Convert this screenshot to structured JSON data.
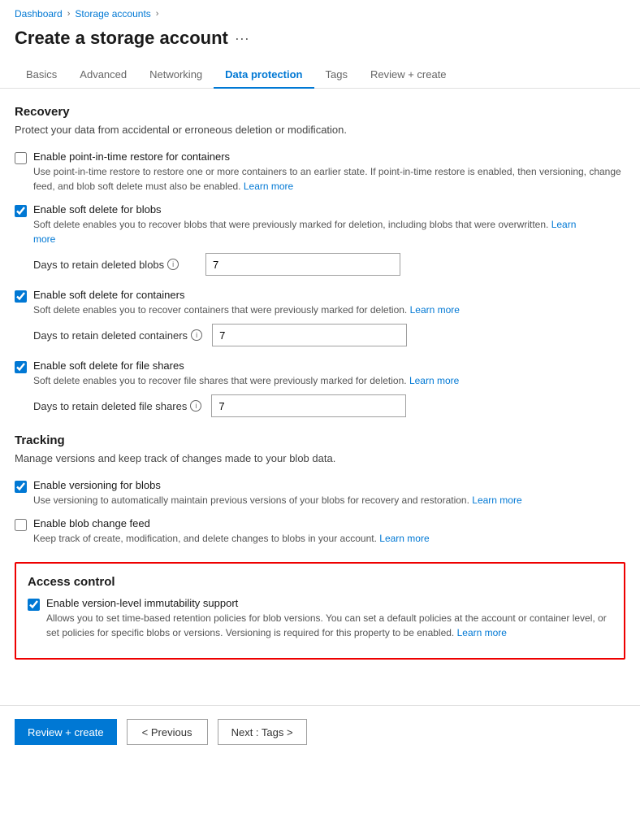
{
  "breadcrumb": {
    "dashboard": "Dashboard",
    "storage_accounts": "Storage accounts"
  },
  "page": {
    "title": "Create a storage account",
    "dots": "···"
  },
  "tabs": [
    {
      "id": "basics",
      "label": "Basics",
      "active": false
    },
    {
      "id": "advanced",
      "label": "Advanced",
      "active": false
    },
    {
      "id": "networking",
      "label": "Networking",
      "active": false
    },
    {
      "id": "data-protection",
      "label": "Data protection",
      "active": true
    },
    {
      "id": "tags",
      "label": "Tags",
      "active": false
    },
    {
      "id": "review-create",
      "label": "Review + create",
      "active": false
    }
  ],
  "recovery": {
    "title": "Recovery",
    "desc": "Protect your data from accidental or erroneous deletion or modification.",
    "point_in_time": {
      "label": "Enable point-in-time restore for containers",
      "desc": "Use point-in-time restore to restore one or more containers to an earlier state. If point-in-time restore is enabled, then versioning, change feed, and blob soft delete must also be enabled.",
      "learn_more": "Learn more",
      "checked": false
    },
    "soft_delete_blobs": {
      "label": "Enable soft delete for blobs",
      "desc": "Soft delete enables you to recover blobs that were previously marked for deletion, including blobs that were overwritten.",
      "learn_more_1": "Learn",
      "learn_more_2": "more",
      "checked": true,
      "days_label": "Days to retain deleted blobs",
      "days_value": "7"
    },
    "soft_delete_containers": {
      "label": "Enable soft delete for containers",
      "desc": "Soft delete enables you to recover containers that were previously marked for deletion.",
      "learn_more": "Learn more",
      "checked": true,
      "days_label": "Days to retain deleted containers",
      "days_value": "7"
    },
    "soft_delete_file_shares": {
      "label": "Enable soft delete for file shares",
      "desc": "Soft delete enables you to recover file shares that were previously marked for deletion.",
      "learn_more": "Learn more",
      "checked": true,
      "days_label": "Days to retain deleted file shares",
      "days_value": "7"
    }
  },
  "tracking": {
    "title": "Tracking",
    "desc": "Manage versions and keep track of changes made to your blob data.",
    "versioning": {
      "label": "Enable versioning for blobs",
      "desc": "Use versioning to automatically maintain previous versions of your blobs for recovery and restoration.",
      "learn_more": "Learn more",
      "checked": true
    },
    "change_feed": {
      "label": "Enable blob change feed",
      "desc": "Keep track of create, modification, and delete changes to blobs in your account.",
      "learn_more": "Learn more",
      "checked": false
    }
  },
  "access_control": {
    "title": "Access control",
    "immutability": {
      "label": "Enable version-level immutability support",
      "desc": "Allows you to set time-based retention policies for blob versions. You can set a default policies at the account or container level, or set policies for specific blobs or versions. Versioning is required for this property to be enabled.",
      "learn_more": "Learn more",
      "checked": true
    }
  },
  "footer": {
    "review_create": "Review + create",
    "previous": "< Previous",
    "next": "Next : Tags >"
  },
  "icons": {
    "info": "i",
    "chevron": "›"
  }
}
